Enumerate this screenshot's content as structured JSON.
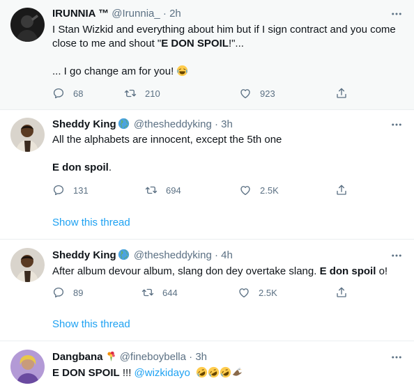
{
  "tweets": [
    {
      "name": "IRUNNIA ™",
      "handle": "@Irunnia_",
      "sep": "·",
      "time": "2h",
      "line1": "I Stan Wizkid and  everything about him but if I sign contract and you come",
      "line2_pre": "close to me and shout \"",
      "line2_bold": "E DON SPOIL",
      "line2_post": "!\"...",
      "line3": "... I go change am for you! ",
      "reply_count": "68",
      "retweet_count": "210",
      "like_count": "923"
    },
    {
      "name": "Sheddy King",
      "handle": "@thesheddyking",
      "sep": "·",
      "time": "3h",
      "line1": "All the alphabets are innocent, except the 5th one",
      "line2_bold": "E don spoil",
      "line2_post": ".",
      "reply_count": "131",
      "retweet_count": "694",
      "like_count": "2.5K",
      "show_thread": "Show this thread"
    },
    {
      "name": "Sheddy King",
      "handle": "@thesheddyking",
      "sep": "·",
      "time": "4h",
      "line1_pre": "After album devour album, slang don dey overtake slang. ",
      "line1_bold": "E don spoil",
      "line1_post": " o!",
      "reply_count": "89",
      "retweet_count": "644",
      "like_count": "2.5K",
      "show_thread": "Show this thread"
    },
    {
      "name": "Dangbana",
      "handle": "@fineboybella",
      "sep": "·",
      "time": "3h",
      "line1_bold": "E DON SPOIL",
      "line1_mid": " !!! ",
      "mention": "@wizkidayo"
    }
  ],
  "colors": {
    "accent": "#1da1f2",
    "muted": "#5b7083",
    "text": "#0f1419",
    "highlight_bg": "#f7f9f9"
  },
  "icons": [
    "more-icon",
    "reply-icon",
    "retweet-icon",
    "like-icon",
    "share-icon",
    "globe-icon",
    "laughing-emoji-icon",
    "rofl-emoji-icon",
    "bouquet-emoji-icon",
    "eagle-emoji-icon"
  ]
}
